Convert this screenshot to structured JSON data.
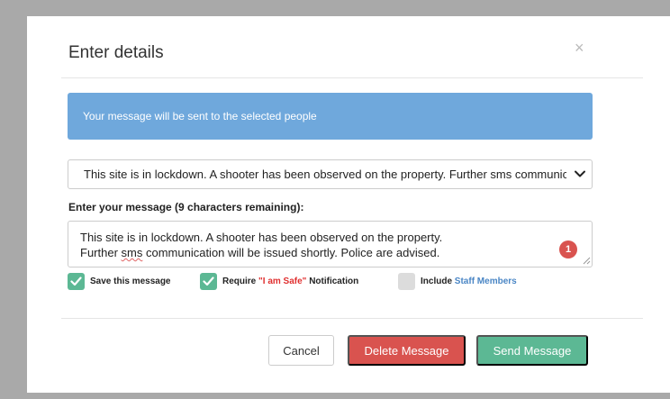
{
  "modal": {
    "title": "Enter details",
    "close_label": "×"
  },
  "alert": {
    "text": "Your message will be sent to the selected people"
  },
  "template_select": {
    "selected": "This site is in lockdown. A shooter has been observed on the property. Further sms communication will be issued shortly. Police are advised."
  },
  "message": {
    "label": "Enter your message (9 characters remaining):",
    "line1": "This site is in lockdown. A shooter has been observed on the property.",
    "line2_pre": "Further ",
    "line2_sms": "sms",
    "line2_post": " communication will be issued shortly. Police are advised.",
    "badge_count": "1"
  },
  "options": {
    "save": {
      "label": "Save this message",
      "checked": true
    },
    "require": {
      "label_pre": "Require ",
      "label_highlight": "\"I am Safe\"",
      "label_post": " Notification",
      "checked": true
    },
    "include": {
      "label_pre": "Include ",
      "label_highlight": "Staff Members",
      "checked": false
    }
  },
  "buttons": {
    "cancel": "Cancel",
    "delete": "Delete Message",
    "send": "Send Message"
  },
  "colors": {
    "alert_bg": "#6fa8dc",
    "success": "#5cb894",
    "danger": "#d9534f",
    "highlight_red": "#e03030",
    "link_blue": "#4a86c5"
  }
}
